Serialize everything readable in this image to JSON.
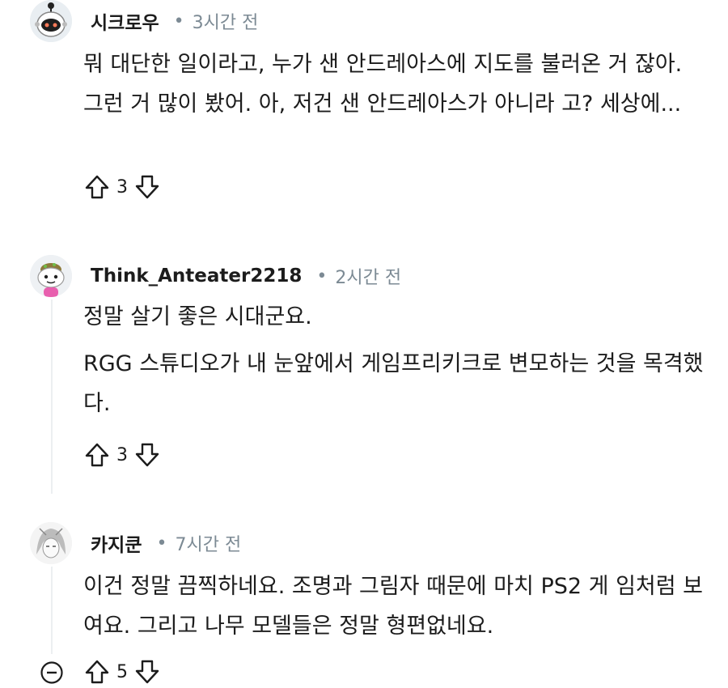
{
  "comments": [
    {
      "username": "시크로우",
      "time": "3시간 전",
      "paragraphs": [
        "뭐 대단한 일이라고, 누가 샌 안드레아스에 지도를 불러온 거 잖아. 그런 거 많이 봤어. 아, 저건 샌 안드레아스가 아니라 고? 세상에..."
      ],
      "score": "3"
    },
    {
      "username": "Think_Anteater2218",
      "time": "2시간 전",
      "paragraphs": [
        "정말 살기 좋은 시대군요.",
        "RGG 스튜디오가 내 눈앞에서 게임프리키크로 변모하는 것을 목격했다."
      ],
      "score": "3"
    },
    {
      "username": "카지쿤",
      "time": "7시간 전",
      "paragraphs": [
        "이건 정말 끔찍하네요. 조명과 그림자 때문에 마치 PS2 게 임처럼 보여요. 그리고 나무 모델들은 정말 형편없네요."
      ],
      "score": "5"
    }
  ]
}
